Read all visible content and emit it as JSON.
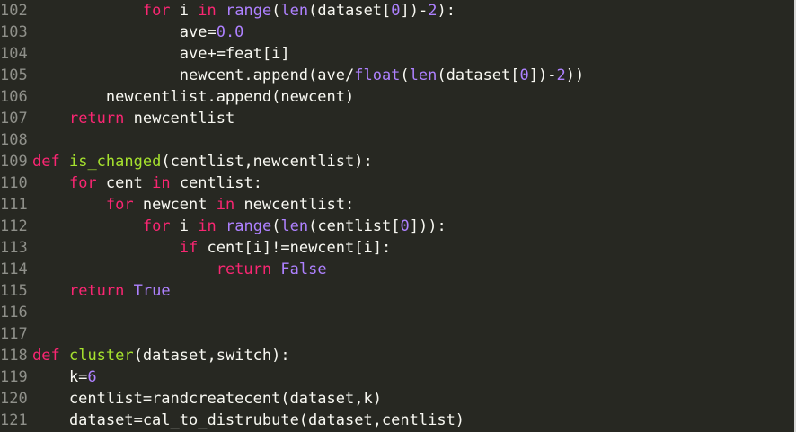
{
  "editor": {
    "lines": [
      {
        "n": "102",
        "tokens": [
          {
            "t": "            "
          },
          {
            "t": "for",
            "c": "kw"
          },
          {
            "t": " i "
          },
          {
            "t": "in",
            "c": "kw"
          },
          {
            "t": " "
          },
          {
            "t": "range",
            "c": "bi"
          },
          {
            "t": "("
          },
          {
            "t": "len",
            "c": "bi"
          },
          {
            "t": "(dataset["
          },
          {
            "t": "0",
            "c": "num"
          },
          {
            "t": "])-"
          },
          {
            "t": "2",
            "c": "num"
          },
          {
            "t": "):"
          }
        ]
      },
      {
        "n": "103",
        "tokens": [
          {
            "t": "                ave="
          },
          {
            "t": "0.0",
            "c": "num"
          }
        ]
      },
      {
        "n": "104",
        "tokens": [
          {
            "t": "                ave+=feat[i]"
          }
        ]
      },
      {
        "n": "105",
        "tokens": [
          {
            "t": "                newcent.append(ave/"
          },
          {
            "t": "float",
            "c": "bi"
          },
          {
            "t": "("
          },
          {
            "t": "len",
            "c": "bi"
          },
          {
            "t": "(dataset["
          },
          {
            "t": "0",
            "c": "num"
          },
          {
            "t": "])-"
          },
          {
            "t": "2",
            "c": "num"
          },
          {
            "t": "))"
          }
        ]
      },
      {
        "n": "106",
        "tokens": [
          {
            "t": "        newcentlist.append(newcent)"
          }
        ]
      },
      {
        "n": "107",
        "tokens": [
          {
            "t": "    "
          },
          {
            "t": "return",
            "c": "kw"
          },
          {
            "t": " newcentlist"
          }
        ]
      },
      {
        "n": "108",
        "tokens": []
      },
      {
        "n": "109",
        "tokens": [
          {
            "t": "def",
            "c": "kw"
          },
          {
            "t": " "
          },
          {
            "t": "is_changed",
            "c": "fn"
          },
          {
            "t": "(centlist,newcentlist):"
          }
        ]
      },
      {
        "n": "110",
        "tokens": [
          {
            "t": "    "
          },
          {
            "t": "for",
            "c": "kw"
          },
          {
            "t": " cent "
          },
          {
            "t": "in",
            "c": "kw"
          },
          {
            "t": " centlist:"
          }
        ]
      },
      {
        "n": "111",
        "tokens": [
          {
            "t": "        "
          },
          {
            "t": "for",
            "c": "kw"
          },
          {
            "t": " newcent "
          },
          {
            "t": "in",
            "c": "kw"
          },
          {
            "t": " newcentlist:"
          }
        ]
      },
      {
        "n": "112",
        "tokens": [
          {
            "t": "            "
          },
          {
            "t": "for",
            "c": "kw"
          },
          {
            "t": " i "
          },
          {
            "t": "in",
            "c": "kw"
          },
          {
            "t": " "
          },
          {
            "t": "range",
            "c": "bi"
          },
          {
            "t": "("
          },
          {
            "t": "len",
            "c": "bi"
          },
          {
            "t": "(centlist["
          },
          {
            "t": "0",
            "c": "num"
          },
          {
            "t": "])):"
          }
        ]
      },
      {
        "n": "113",
        "tokens": [
          {
            "t": "                "
          },
          {
            "t": "if",
            "c": "kw"
          },
          {
            "t": " cent[i]!=newcent[i]:"
          }
        ]
      },
      {
        "n": "114",
        "tokens": [
          {
            "t": "                    "
          },
          {
            "t": "return",
            "c": "kw"
          },
          {
            "t": " "
          },
          {
            "t": "False",
            "c": "const"
          }
        ]
      },
      {
        "n": "115",
        "tokens": [
          {
            "t": "    "
          },
          {
            "t": "return",
            "c": "kw"
          },
          {
            "t": " "
          },
          {
            "t": "True",
            "c": "const"
          }
        ]
      },
      {
        "n": "116",
        "tokens": []
      },
      {
        "n": "117",
        "tokens": []
      },
      {
        "n": "118",
        "tokens": [
          {
            "t": "def",
            "c": "kw"
          },
          {
            "t": " "
          },
          {
            "t": "cluster",
            "c": "fn"
          },
          {
            "t": "(dataset,switch):"
          }
        ]
      },
      {
        "n": "119",
        "tokens": [
          {
            "t": "    k="
          },
          {
            "t": "6",
            "c": "num"
          }
        ]
      },
      {
        "n": "120",
        "tokens": [
          {
            "t": "    centlist=randcreatecent(dataset,k)"
          }
        ]
      },
      {
        "n": "121",
        "tokens": [
          {
            "t": "    dataset=cal_to_distrubute(dataset,centlist)"
          }
        ]
      }
    ]
  }
}
